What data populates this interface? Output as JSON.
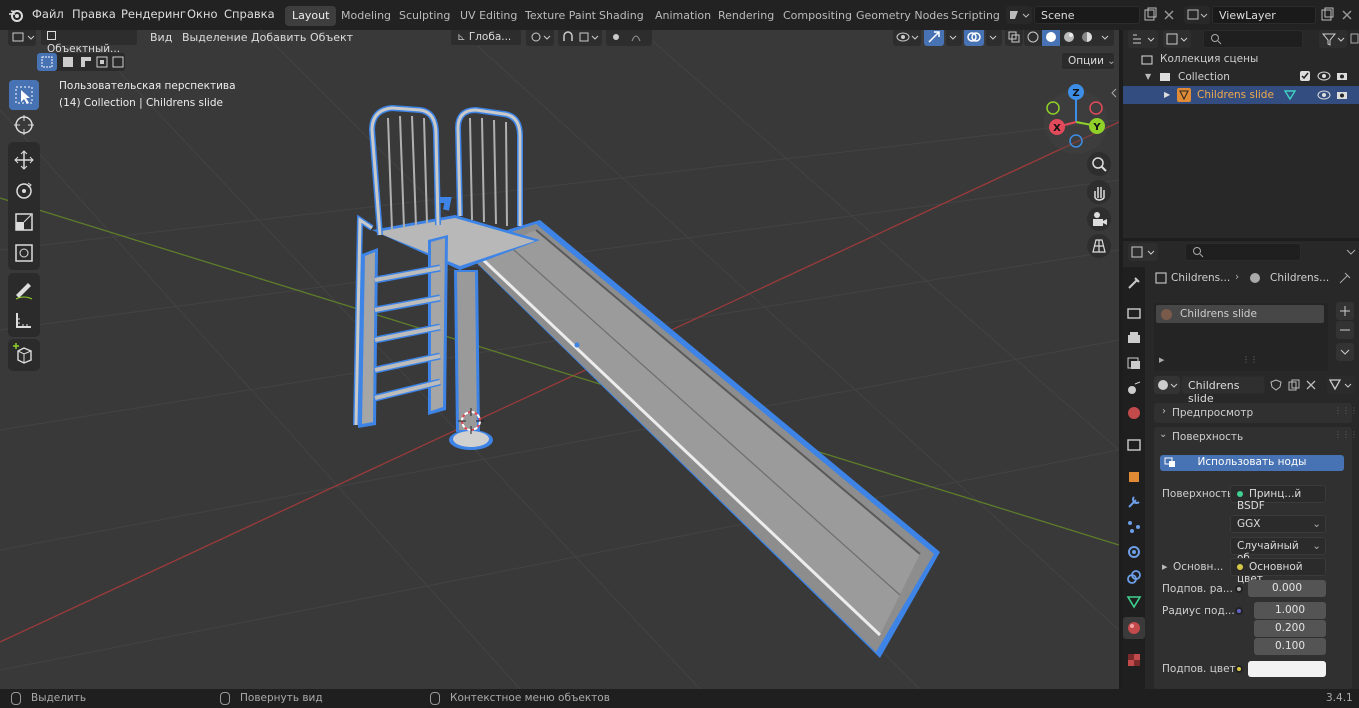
{
  "topbar": {
    "menus": [
      "Файл",
      "Правка",
      "Рендеринг",
      "Окно",
      "Справка"
    ],
    "workspaces": [
      "Layout",
      "Modeling",
      "Sculpting",
      "UV Editing",
      "Texture Paint",
      "Shading",
      "Animation",
      "Rendering",
      "Compositing",
      "Geometry Nodes",
      "Scripting"
    ],
    "active_workspace": "Layout",
    "scene": "Scene",
    "view_layer": "ViewLayer"
  },
  "viewport": {
    "mode": "Объектный...",
    "menus": [
      "Вид",
      "Выделение",
      "Добавить",
      "Объект"
    ],
    "transform_orientation": "Глоба...",
    "options_label": "Опции",
    "overlay_line1": "Пользовательская перспектива",
    "overlay_line2": "(14) Collection | Childrens slide",
    "gizmo": {
      "z": "Z",
      "y": "Y",
      "x": "X"
    }
  },
  "outliner": {
    "scene_collection": "Коллекция сцены",
    "collection": "Collection",
    "object": "Childrens slide"
  },
  "properties": {
    "breadcrumb_object": "Childrens...",
    "breadcrumb_material": "Childrens...",
    "material_slot": "Childrens slide",
    "material_name": "Childrens slide",
    "preview_label": "Предпросмотр",
    "surface_panel": "Поверхность",
    "use_nodes_button": "Использовать ноды",
    "surface_label": "Поверхность",
    "surface_value": "Принц...й BSDF",
    "distribution": "GGX",
    "subsurface_method": "Случайный об...",
    "base_color_label": "Основн...",
    "base_color_value": "Основной цвет",
    "subsurface_label": "Подпов. ра...",
    "subsurface_value": "0.000",
    "radius_label": "Радиус под...",
    "radius_values": [
      "1.000",
      "0.200",
      "0.100"
    ],
    "subsurface_color_label": "Подпов. цвет"
  },
  "statusbar": {
    "select": "Выделить",
    "rotate": "Повернуть вид",
    "context": "Контекстное меню объектов",
    "version": "3.4.1"
  },
  "colors": {
    "accent": "#4772b3",
    "selection_outline": "#3d84e6",
    "x_axis": "#e04a5a",
    "y_axis": "#8fd129",
    "z_axis": "#3c8ee6"
  }
}
